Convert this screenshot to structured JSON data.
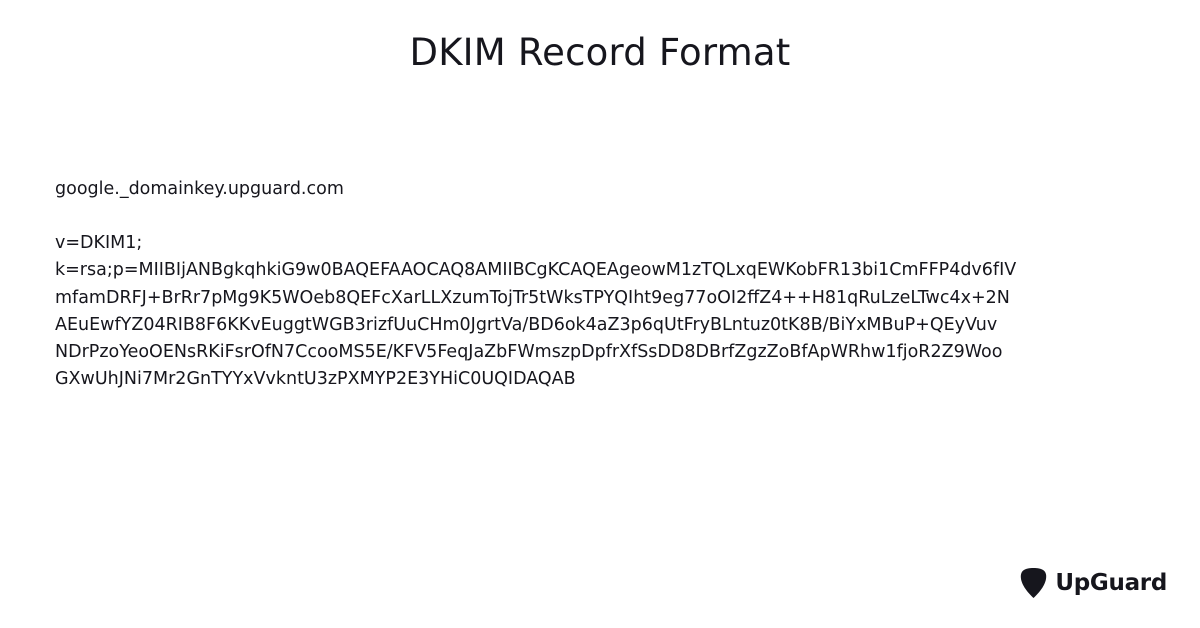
{
  "title": "DKIM Record Format",
  "record": {
    "name": "google._domainkey.upguard.com",
    "version_line": "v=DKIM1;",
    "key_lines": [
      "k=rsa;p=MIIBIjANBgkqhkiG9w0BAQEFAAOCAQ8AMIIBCgKCAQEAgeowM1zTQLxqEWKobFR13bi1CmFFP4dv6fIV",
      "mfamDRFJ+BrRr7pMg9K5WOeb8QEFcXarLLXzumTojTr5tWksTPYQIht9eg77oOI2ffZ4++H81qRuLzeLTwc4x+2N",
      "AEuEwfYZ04RIB8F6KKvEuggtWGB3rizfUuCHm0JgrtVa/BD6ok4aZ3p6qUtFryBLntuz0tK8B/BiYxMBuP+QEyVuv",
      "NDrPzoYeoOENsRKiFsrOfN7CcooMS5E/KFV5FeqJaZbFWmszpDpfrXfSsDD8DBrfZgzZoBfApWRhw1fjoR2Z9Woo",
      "GXwUhJNi7Mr2GnTYYxVvkntU3zPXMYP2E3YHiC0UQIDAQAB"
    ]
  },
  "brand": {
    "name": "UpGuard",
    "icon": "guitar-pick-shield-icon"
  }
}
